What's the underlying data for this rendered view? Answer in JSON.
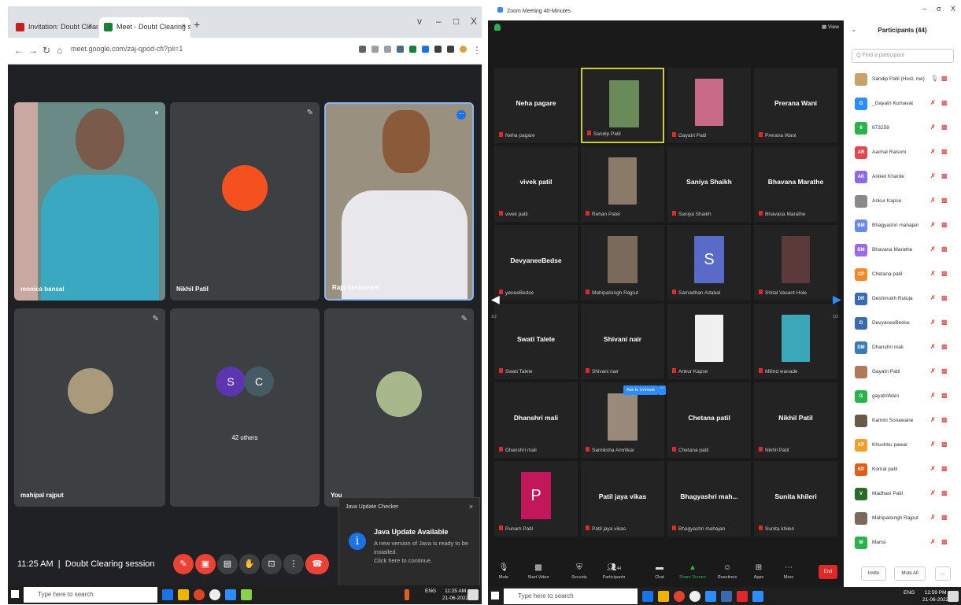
{
  "meet": {
    "tabs": [
      {
        "label": "Invitation: Doubt Clearing sessi",
        "favicon_color": "#c5221f"
      },
      {
        "label": "Meet - Doubt Clearing sessi",
        "favicon_color": "#188038"
      }
    ],
    "new_tab": "+",
    "window_controls": [
      "v",
      "–",
      "□",
      "X"
    ],
    "url": "meet.google.com/zaj-qpod-cfi?pli=1",
    "tiles": [
      {
        "name": "monica bansal"
      },
      {
        "name": "Nikhil Patil"
      },
      {
        "name": "Raja Venkatram"
      },
      {
        "name": "mahipal rajput"
      },
      {
        "name": "42 others"
      },
      {
        "name": "You"
      }
    ],
    "others_avatars": [
      "S",
      "C"
    ],
    "clock": "11:25 AM",
    "separator": "|",
    "meeting_title": "Doubt Clearing session",
    "java": {
      "header": "Java Update Checker",
      "icon": "i",
      "title": "Java Update Available",
      "body": "A new version of Java is ready to be installed.",
      "link": "Click here to continue."
    },
    "taskbar": {
      "search": "Type here to search",
      "time": "11:25 AM",
      "date": "21-06-2022",
      "lang": "ENG"
    }
  },
  "zoom": {
    "window_title": "Zoom Meeting 40-Minutes",
    "view_label": "View",
    "page_left": "1/2",
    "page_right": "1/2",
    "tiles": [
      {
        "big": "Neha pagare",
        "small": "Neha pagare"
      },
      {
        "big": "",
        "small": "Sandip Patil"
      },
      {
        "big": "",
        "small": "Gayatri Patil"
      },
      {
        "big": "Prerana Wani",
        "small": "Prerana Wani"
      },
      {
        "big": "vivek patil",
        "small": "vivek patil"
      },
      {
        "big": "",
        "small": "Rehan Patel"
      },
      {
        "big": "Saniya Shaikh",
        "small": "Saniya Shaikh"
      },
      {
        "big": "Bhavana Marathe",
        "small": "Bhavana Marathe"
      },
      {
        "big": "DevyaneeBedse",
        "small": "yaneeBedse"
      },
      {
        "big": "",
        "small": "Mahipalsingh Rajput"
      },
      {
        "big": "",
        "small": "Samadhan Adabal"
      },
      {
        "big": "",
        "small": "Shital Vasant Hole"
      },
      {
        "big": "Swati Talele",
        "small": "Swati Talele"
      },
      {
        "big": "Shivani nair",
        "small": "Shivani nair"
      },
      {
        "big": "",
        "small": "Ankur Kapse"
      },
      {
        "big": "",
        "small": "Milind wanade"
      },
      {
        "big": "Dhanshri mali",
        "small": "Dhanshri mali"
      },
      {
        "big": "",
        "small": "Samiksha Amritkar"
      },
      {
        "big": "Chetana patil",
        "small": "Chetana patil"
      },
      {
        "big": "Nikhil Patil",
        "small": "Nikhil Patil"
      },
      {
        "big": "",
        "small": "Punam Patil"
      },
      {
        "big": "Patil jaya vikas",
        "small": "Patil jaya vikas"
      },
      {
        "big": "Bhagyashri mah...",
        "small": "Bhagyashri mahajan"
      },
      {
        "big": "Sunita khileri",
        "small": "Sunita khileri"
      }
    ],
    "letter_tiles": [
      "S",
      "P"
    ],
    "ask_unmute": "Ask to Unmute",
    "toolbar": [
      "Mute",
      "Start Video",
      "Security",
      "Participants",
      "Chat",
      "Share Screen",
      "Reactions",
      "Apps",
      "More"
    ],
    "participant_count": "44",
    "end_label": "End",
    "participants": {
      "title": "Participants (44)",
      "search_placeholder": "Q Find a participant",
      "items": [
        {
          "name": "Sandip Patil (Host, me)",
          "initials": "",
          "color": "#c9a26a"
        },
        {
          "name": "_Gayatri Kumavat",
          "initials": "G",
          "color": "#2d8cff"
        },
        {
          "name": "873258",
          "initials": "8",
          "color": "#2bb24c"
        },
        {
          "name": "Aachal Raisoni",
          "initials": "AR",
          "color": "#e0484f"
        },
        {
          "name": "Aniket Kharde",
          "initials": "AK",
          "color": "#8c6ae8"
        },
        {
          "name": "Ankur Kapse",
          "initials": "",
          "color": "#8a8a8a"
        },
        {
          "name": "Bhagyashri mahajan",
          "initials": "BM",
          "color": "#6a8ae8"
        },
        {
          "name": "Bhavana Marathe",
          "initials": "BM",
          "color": "#9a6ae8"
        },
        {
          "name": "Chetana patil",
          "initials": "CP",
          "color": "#f08a28"
        },
        {
          "name": "Deshmukh Rutuja",
          "initials": "DR",
          "color": "#3a6ab0"
        },
        {
          "name": "DevyaneeBedse",
          "initials": "D",
          "color": "#3a6ab0"
        },
        {
          "name": "Dhanshri mali",
          "initials": "DM",
          "color": "#3a7ab8"
        },
        {
          "name": "Gayatri Patil",
          "initials": "",
          "color": "#b07a5a"
        },
        {
          "name": "gayatriWani",
          "initials": "G",
          "color": "#2bb24c"
        },
        {
          "name": "Kamini Sonawane",
          "initials": "",
          "color": "#6a5a4a"
        },
        {
          "name": "Khushbu pawar",
          "initials": "KP",
          "color": "#f0a028"
        },
        {
          "name": "Komal patil",
          "initials": "KP",
          "color": "#e0601a"
        },
        {
          "name": "Madhavi Patil",
          "initials": "V",
          "color": "#2a6a2a"
        },
        {
          "name": "Mahipalsingh Rajput",
          "initials": "",
          "color": "#7a6a5a"
        },
        {
          "name": "Mansi",
          "initials": "M",
          "color": "#2bb24c"
        }
      ],
      "invite": "Invite",
      "mute_all": "Mute All",
      "more": "..."
    },
    "taskbar": {
      "search": "Type here to search",
      "time": "12:59 PM",
      "date": "21-06-2022",
      "lang": "ENG"
    },
    "window_controls": [
      "–",
      "σ",
      "X"
    ]
  }
}
